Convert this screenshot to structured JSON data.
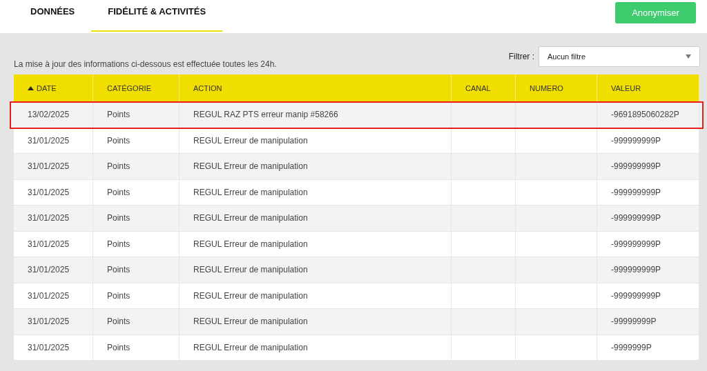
{
  "tabs": [
    {
      "label": "DONNÉES",
      "selected": false
    },
    {
      "label": "FIDÉLITÉ & ACTIVITÉS",
      "selected": true
    }
  ],
  "actions": {
    "anonymize_button": "Anonymiser"
  },
  "info_text": "La mise à jour des informations ci-dessous est effectuée toutes les 24h.",
  "filter": {
    "label": "Filtrer :",
    "value": "Aucun filtre"
  },
  "table": {
    "columns": [
      {
        "label": "DATE",
        "sorted": true
      },
      {
        "label": "CATÉGORIE",
        "sorted": false
      },
      {
        "label": "ACTION",
        "sorted": false
      },
      {
        "label": "CANAL",
        "sorted": false
      },
      {
        "label": "NUMERO",
        "sorted": false
      },
      {
        "label": "VALEUR",
        "sorted": false
      }
    ],
    "rows": [
      {
        "cells": [
          "13/02/2025",
          "Points",
          "REGUL RAZ PTS erreur manip #58266",
          "",
          "",
          "-9691895060282P"
        ],
        "highlighted": true
      },
      {
        "cells": [
          "31/01/2025",
          "Points",
          "REGUL Erreur de manipulation",
          "",
          "",
          "-999999999P"
        ],
        "highlighted": false
      },
      {
        "cells": [
          "31/01/2025",
          "Points",
          "REGUL Erreur de manipulation",
          "",
          "",
          "-999999999P"
        ],
        "highlighted": false
      },
      {
        "cells": [
          "31/01/2025",
          "Points",
          "REGUL Erreur de manipulation",
          "",
          "",
          "-999999999P"
        ],
        "highlighted": false
      },
      {
        "cells": [
          "31/01/2025",
          "Points",
          "REGUL Erreur de manipulation",
          "",
          "",
          "-999999999P"
        ],
        "highlighted": false
      },
      {
        "cells": [
          "31/01/2025",
          "Points",
          "REGUL Erreur de manipulation",
          "",
          "",
          "-999999999P"
        ],
        "highlighted": false
      },
      {
        "cells": [
          "31/01/2025",
          "Points",
          "REGUL Erreur de manipulation",
          "",
          "",
          "-999999999P"
        ],
        "highlighted": false
      },
      {
        "cells": [
          "31/01/2025",
          "Points",
          "REGUL Erreur de manipulation",
          "",
          "",
          "-999999999P"
        ],
        "highlighted": false
      },
      {
        "cells": [
          "31/01/2025",
          "Points",
          "REGUL Erreur de manipulation",
          "",
          "",
          "-99999999P"
        ],
        "highlighted": false
      },
      {
        "cells": [
          "31/01/2025",
          "Points",
          "REGUL Erreur de manipulation",
          "",
          "",
          "-9999999P"
        ],
        "highlighted": false
      }
    ]
  }
}
